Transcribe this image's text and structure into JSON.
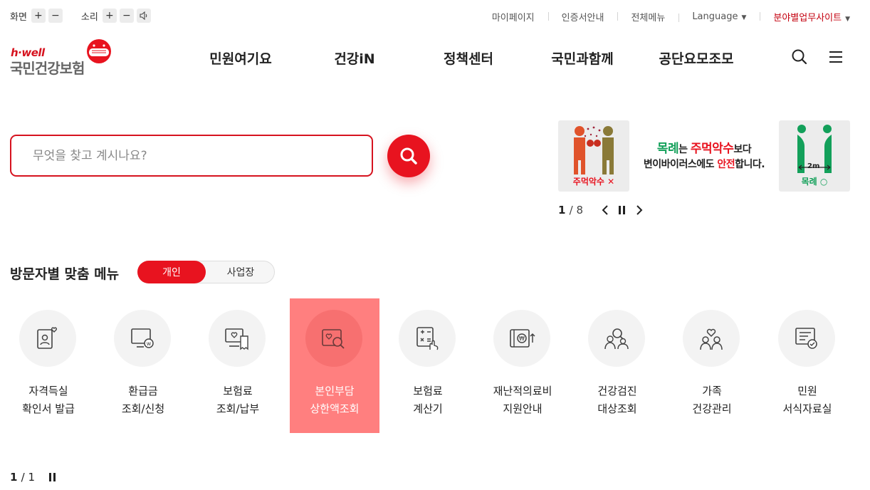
{
  "utility": {
    "screen_label": "화면",
    "sound_label": "소리",
    "plus": "+",
    "minus": "−",
    "links": [
      "마이페이지",
      "인증서안내",
      "전체메뉴",
      "Language",
      "분야별업무사이트"
    ]
  },
  "logo": {
    "tagline": "h·well",
    "name": "국민건강보험"
  },
  "gnb": [
    "민원여기요",
    "건강iN",
    "정책센터",
    "국민과함께",
    "공단요모조모"
  ],
  "search": {
    "placeholder": "무엇을 찾고 계시나요?"
  },
  "banner": {
    "left_tile_label": "주먹악수 ✕",
    "right_tile_label": "목례 ○",
    "distance_label": "2m",
    "line1": {
      "a": "목례",
      "b": "는 ",
      "c": "주먹악수",
      "d": "보다"
    },
    "line2": {
      "a": "변이바이러스에도 ",
      "b": "안전",
      "c": "합니다."
    },
    "current": "1",
    "total": "/ 8"
  },
  "visitor_menu": {
    "title": "방문자별 맞춤 메뉴",
    "tabs": [
      "개인",
      "사업장"
    ],
    "items": [
      {
        "line1": "자격득실",
        "line2": "확인서 발급"
      },
      {
        "line1": "환급금",
        "line2": "조회/신청"
      },
      {
        "line1": "보험료",
        "line2": "조회/납부"
      },
      {
        "line1": "본인부담",
        "line2": "상한액조회"
      },
      {
        "line1": "보험료",
        "line2": "계산기"
      },
      {
        "line1": "재난적의료비",
        "line2": "지원안내"
      },
      {
        "line1": "건강검진",
        "line2": "대상조회"
      },
      {
        "line1": "가족",
        "line2": "건강관리"
      },
      {
        "line1": "민원",
        "line2": "서식자료실"
      }
    ],
    "current": "1",
    "total": "/ 1"
  },
  "colors": {
    "accent": "#e8131f",
    "highlight": "#ff7f7f",
    "green": "#13a05a"
  }
}
